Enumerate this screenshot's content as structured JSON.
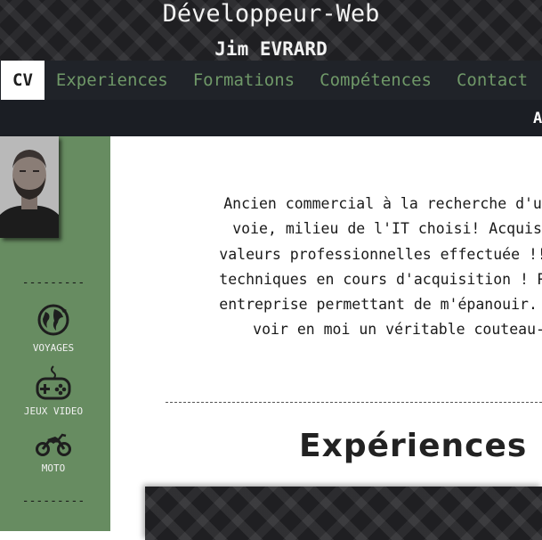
{
  "header": {
    "title": "Développeur-Web",
    "subtitle": "Jim EVRARD"
  },
  "nav": {
    "items": [
      {
        "label": "CV",
        "active": true
      },
      {
        "label": "Experiences",
        "active": false
      },
      {
        "label": "Formations",
        "active": false
      },
      {
        "label": "Compétences",
        "active": false
      },
      {
        "label": "Contact",
        "active": false
      }
    ],
    "subnav_label": "A"
  },
  "sidebar": {
    "separator": "---------",
    "hobbies": [
      {
        "label": "VOYAGES",
        "icon": "globe-icon"
      },
      {
        "label": "JEUX VIDEO",
        "icon": "gamepad-icon"
      },
      {
        "label": "MOTO",
        "icon": "motorcycle-icon"
      }
    ]
  },
  "about": {
    "lines": [
      "Ancien commercial à la recherche d'une",
      "voie, milieu de l'IT choisi! Acquisit",
      "valeurs professionnelles effectuée !! C",
      "techniques en cours d'acquisition ! Rec",
      "entreprise permettant de m'épanouir. Vo",
      "voir en moi un véritable couteau-su"
    ]
  },
  "experiences": {
    "title": "Expériences"
  },
  "colors": {
    "accent_green": "#678c61",
    "nav_green_text": "#6f9868",
    "dark": "#1f1f22"
  }
}
